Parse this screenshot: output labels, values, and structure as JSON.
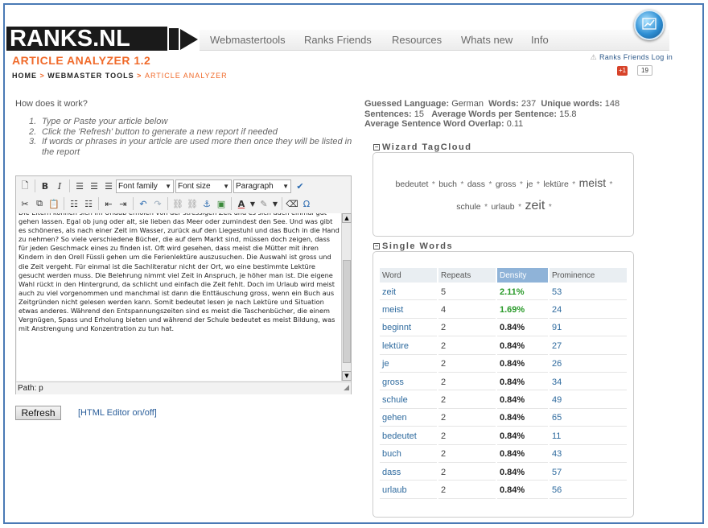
{
  "header": {
    "logo_text": "RANKS.NL",
    "nav": [
      "Webmastertools",
      "Ranks Friends",
      "Resources",
      "Whats new",
      "Info"
    ],
    "page_title": "ARTICLE ANALYZER 1.2",
    "breadcrumb": {
      "home": "HOME",
      "sep": ">",
      "tools": "WEBMASTER TOOLS",
      "current": "ARTICLE ANALYZER"
    },
    "ranks_friends_login": "Ranks Friends Log in",
    "gplus_label": "+1",
    "gplus_count": "19"
  },
  "help": {
    "heading": "How does it work?",
    "steps": [
      {
        "num": "1.",
        "text": "Type or Paste your article below"
      },
      {
        "num": "2.",
        "text": "Click the 'Refresh' button to generate a new report if needed"
      },
      {
        "num": "3.",
        "text": "If words or phrases in your article are used more then once they will be listed in the report"
      }
    ]
  },
  "editor": {
    "font_family": "Font family",
    "font_size": "Font size",
    "format": "Paragraph",
    "content": "Die Eltern können sich im Urlaub erholen von der stressigen Zeit und es sich auch einmal gut gehen lassen. Egal ob jung oder alt, sie lieben das Meer oder zumindest den See. Und was gibt es schöneres, als nach einer Zeit im Wasser, zurück auf den Liegestuhl und das Buch in die Hand zu nehmen? So viele verschiedene Bücher, die auf dem Markt sind, müssen doch zeigen, dass für jeden Geschmack eines zu finden ist. Oft wird gesehen, dass meist die Mütter mit ihren Kindern in den Orell Füssli gehen um die Ferienlektüre auszusuchen. Die Auswahl ist gross und die Zeit vergeht. Für einmal ist die Sachliteratur nicht der Ort, wo eine bestimmte Lektüre gesucht werden muss. Die Belehrung nimmt viel Zeit in Anspruch, je höher man ist. Die eigene Wahl rückt in den Hintergrund, da schlicht und einfach die Zeit fehlt. Doch im Urlaub wird meist auch zu viel vorgenommen und manchmal ist dann die Enttäuschung gross, wenn ein Buch aus Zeitgründen nicht gelesen werden kann. Somit bedeutet lesen je nach Lektüre und Situation etwas anderes. Während den Entspannungszeiten sind es meist die Taschenbücher, die einem Vergnügen, Spass und Erholung bieten und während der Schule bedeutet es meist Bildung, was mit Anstrengung und Konzentration zu tun hat.",
    "path": "Path: p"
  },
  "actions": {
    "refresh_label": "Refresh",
    "html_editor_toggle": "[HTML Editor on/off]"
  },
  "stats": {
    "lang_label": "Guessed Language:",
    "lang_value": "German",
    "words_label": "Words:",
    "words_value": "237",
    "unique_label": "Unique words:",
    "unique_value": "148",
    "sentences_label": "Sentences:",
    "sentences_value": "15",
    "avg_words_label": "Average Words per Sentence:",
    "avg_words_value": "15.8",
    "overlap_label": "Average Sentence Word Overlap:",
    "overlap_value": "0.11"
  },
  "tagcloud": {
    "title": "Wizard TagCloud",
    "words": [
      {
        "text": "bedeutet",
        "size": "s"
      },
      {
        "text": "buch",
        "size": "s"
      },
      {
        "text": "dass",
        "size": "s"
      },
      {
        "text": "gross",
        "size": "s"
      },
      {
        "text": "je",
        "size": "s"
      },
      {
        "text": "lektüre",
        "size": "s"
      },
      {
        "text": "meist",
        "size": "m"
      },
      {
        "text": "schule",
        "size": "s"
      },
      {
        "text": "urlaub",
        "size": "s"
      },
      {
        "text": "zeit",
        "size": "l"
      }
    ]
  },
  "single_words": {
    "title": "Single Words",
    "columns": [
      "Word",
      "Repeats",
      "Density",
      "Prominence"
    ],
    "rows": [
      {
        "word": "zeit",
        "repeats": "5",
        "density": "2.11%",
        "prominence": "53",
        "highlight": true
      },
      {
        "word": "meist",
        "repeats": "4",
        "density": "1.69%",
        "prominence": "24",
        "highlight": true
      },
      {
        "word": "beginnt",
        "repeats": "2",
        "density": "0.84%",
        "prominence": "91",
        "highlight": false
      },
      {
        "word": "lektüre",
        "repeats": "2",
        "density": "0.84%",
        "prominence": "27",
        "highlight": false
      },
      {
        "word": "je",
        "repeats": "2",
        "density": "0.84%",
        "prominence": "26",
        "highlight": false
      },
      {
        "word": "gross",
        "repeats": "2",
        "density": "0.84%",
        "prominence": "34",
        "highlight": false
      },
      {
        "word": "schule",
        "repeats": "2",
        "density": "0.84%",
        "prominence": "49",
        "highlight": false
      },
      {
        "word": "gehen",
        "repeats": "2",
        "density": "0.84%",
        "prominence": "65",
        "highlight": false
      },
      {
        "word": "bedeutet",
        "repeats": "2",
        "density": "0.84%",
        "prominence": "11",
        "highlight": false
      },
      {
        "word": "buch",
        "repeats": "2",
        "density": "0.84%",
        "prominence": "43",
        "highlight": false
      },
      {
        "word": "dass",
        "repeats": "2",
        "density": "0.84%",
        "prominence": "57",
        "highlight": false
      },
      {
        "word": "urlaub",
        "repeats": "2",
        "density": "0.84%",
        "prominence": "56",
        "highlight": false
      }
    ]
  },
  "colors": {
    "accent_orange": "#f06a2a",
    "link_blue": "#2e6a9e",
    "density_green": "#2a9a2a",
    "frame_blue": "#4a7ab5"
  }
}
